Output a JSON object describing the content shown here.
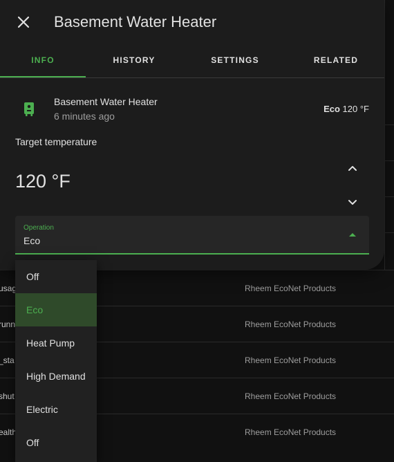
{
  "dialog": {
    "title": "Basement Water Heater",
    "tabs": [
      {
        "label": "INFO",
        "active": true
      },
      {
        "label": "HISTORY",
        "active": false
      },
      {
        "label": "SETTINGS",
        "active": false
      },
      {
        "label": "RELATED",
        "active": false
      }
    ]
  },
  "entity": {
    "name": "Basement Water Heater",
    "last_changed": "6 minutes ago",
    "state_mode": "Eco",
    "state_temp": "120 °F"
  },
  "target": {
    "label": "Target temperature",
    "value": "120 °F"
  },
  "operation": {
    "label": "Operation",
    "value": "Eco",
    "options": [
      "Off",
      "Eco",
      "Heat Pump",
      "High Demand",
      "Electric",
      "Off"
    ],
    "selected_index": 1
  },
  "background_rows": [
    {
      "left": "usag",
      "right": "Rheem EcoNet Products"
    },
    {
      "left": "runn",
      "right": "Rheem EcoNet Products"
    },
    {
      "left": "_sta",
      "right": "Rheem EcoNet Products"
    },
    {
      "left": "shut",
      "right": "Rheem EcoNet Products"
    },
    {
      "left": "ealth",
      "right": "Rheem EcoNet Products"
    }
  ],
  "colors": {
    "accent": "#4caf50",
    "surface": "#1c1c1c",
    "background": "#111111"
  }
}
